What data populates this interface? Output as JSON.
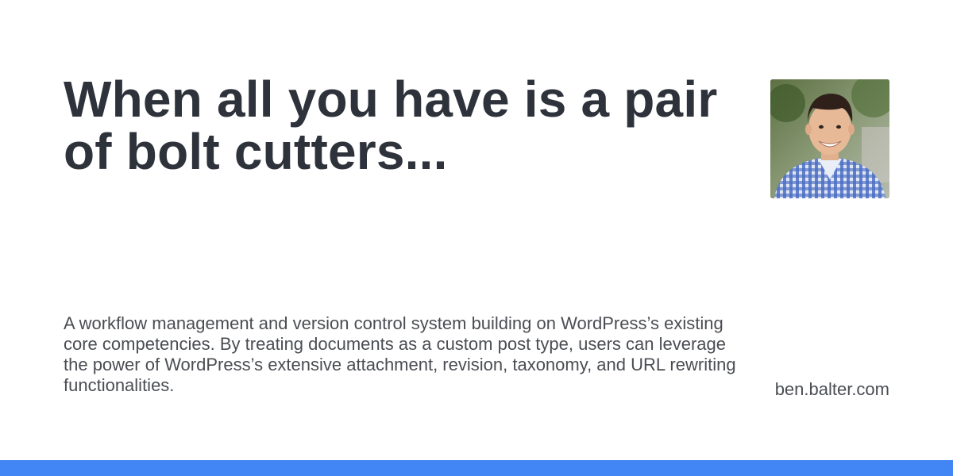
{
  "post": {
    "title": "When all you have is a pair of bolt cutters...",
    "description": "A workflow management and version control system building on WordPress’s existing core competencies. By treating documents as a custom post type, users can leverage the power of WordPress’s extensive attachment, revision, taxonomy, and URL rewriting functionalities."
  },
  "site": {
    "domain": "ben.balter.com"
  },
  "avatar": {
    "icon": "author-photo"
  },
  "colors": {
    "accent": "#4285f4",
    "title": "#2e323b",
    "text": "#4a4d52",
    "background": "#ffffff"
  }
}
